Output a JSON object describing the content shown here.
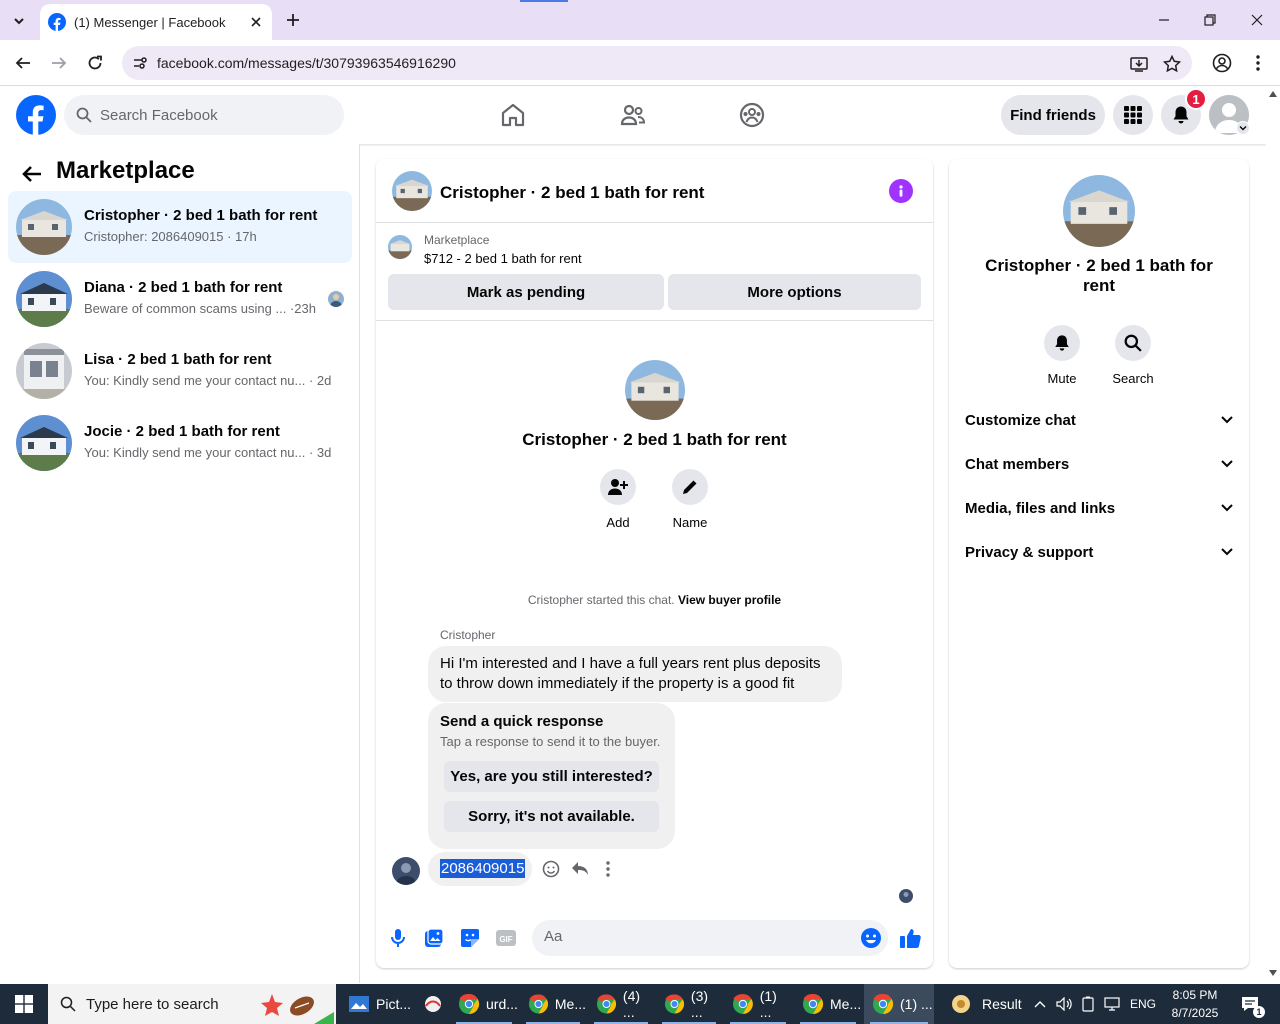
{
  "browser": {
    "tab_title": "(1) Messenger | Facebook",
    "url": "facebook.com/messages/t/30793963546916290"
  },
  "fb": {
    "search_placeholder": "Search Facebook",
    "find_friends": "Find friends",
    "notification_count": "1"
  },
  "sidebar": {
    "title": "Marketplace",
    "conversations": [
      {
        "name": "Cristopher · 2 bed 1 bath for rent",
        "snippet": "Cristopher: 2086409015 · 17h"
      },
      {
        "name": "Diana · 2 bed 1 bath for rent",
        "snippet": "Beware of common scams using ... ·23h"
      },
      {
        "name": "Lisa · 2 bed 1 bath for rent",
        "snippet": "You: Kindly send me your contact nu... · 2d"
      },
      {
        "name": "Jocie · 2 bed 1 bath for rent",
        "snippet": "You: Kindly send me your contact nu... · 3d"
      }
    ]
  },
  "chat": {
    "header_name": "Cristopher · 2 bed 1 bath for rent",
    "listing_source": "Marketplace",
    "listing_price": "$712 - 2 bed 1 bath for rent",
    "mark_pending": "Mark as pending",
    "more_options": "More options",
    "profile_name": "Cristopher · 2 bed 1 bath for rent",
    "add_label": "Add",
    "name_label": "Name",
    "started_text": "Cristopher started this chat.",
    "view_buyer_profile": "View buyer profile",
    "sender": "Cristopher",
    "message": "Hi I'm interested and I have a full years rent plus deposits to throw down immediately if the property is a good fit",
    "quick_title": "Send a quick response",
    "quick_sub": "Tap a response to send it to the buyer.",
    "quick_1": "Yes, are you still interested?",
    "quick_2": "Sorry, it's not available.",
    "my_message": "2086409015",
    "composer_placeholder": "Aa"
  },
  "right": {
    "name": "Cristopher · 2 bed 1 bath for rent",
    "mute": "Mute",
    "search": "Search",
    "sections": [
      "Customize chat",
      "Chat members",
      "Media, files and links",
      "Privacy & support"
    ]
  },
  "taskbar": {
    "search_placeholder": "Type here to search",
    "apps": [
      "Pict...",
      "urd...",
      "Me...",
      "(4) ...",
      "(3) ...",
      "(1) ...",
      "Me...",
      "(1) ..."
    ],
    "result": "Result",
    "lang": "ENG",
    "time": "8:05 PM",
    "date": "8/7/2025"
  },
  "colors": {
    "fb_blue": "#0866ff",
    "messenger_purple": "#a033ff",
    "active_conv": "#ebf5ff"
  }
}
